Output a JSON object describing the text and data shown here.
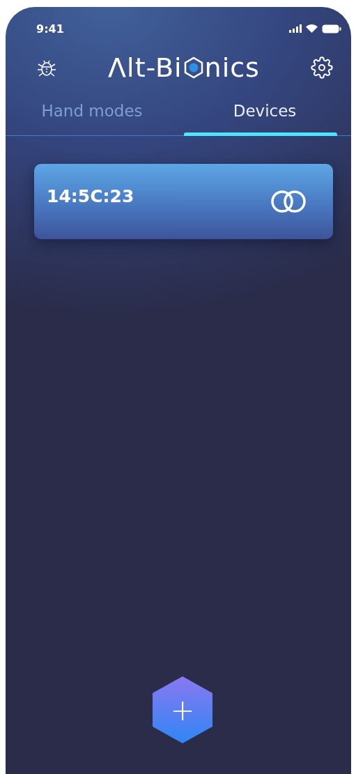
{
  "status_bar": {
    "time": "9:41"
  },
  "header": {
    "logo_before": "Λlt-Bi",
    "logo_after": "nics"
  },
  "tabs": [
    {
      "label": "Hand modes",
      "selected": false
    },
    {
      "label": "Devices",
      "selected": true
    }
  ],
  "devices": [
    {
      "name": "14:5C:23",
      "connected": true
    }
  ],
  "fab": {
    "label": "+"
  }
}
